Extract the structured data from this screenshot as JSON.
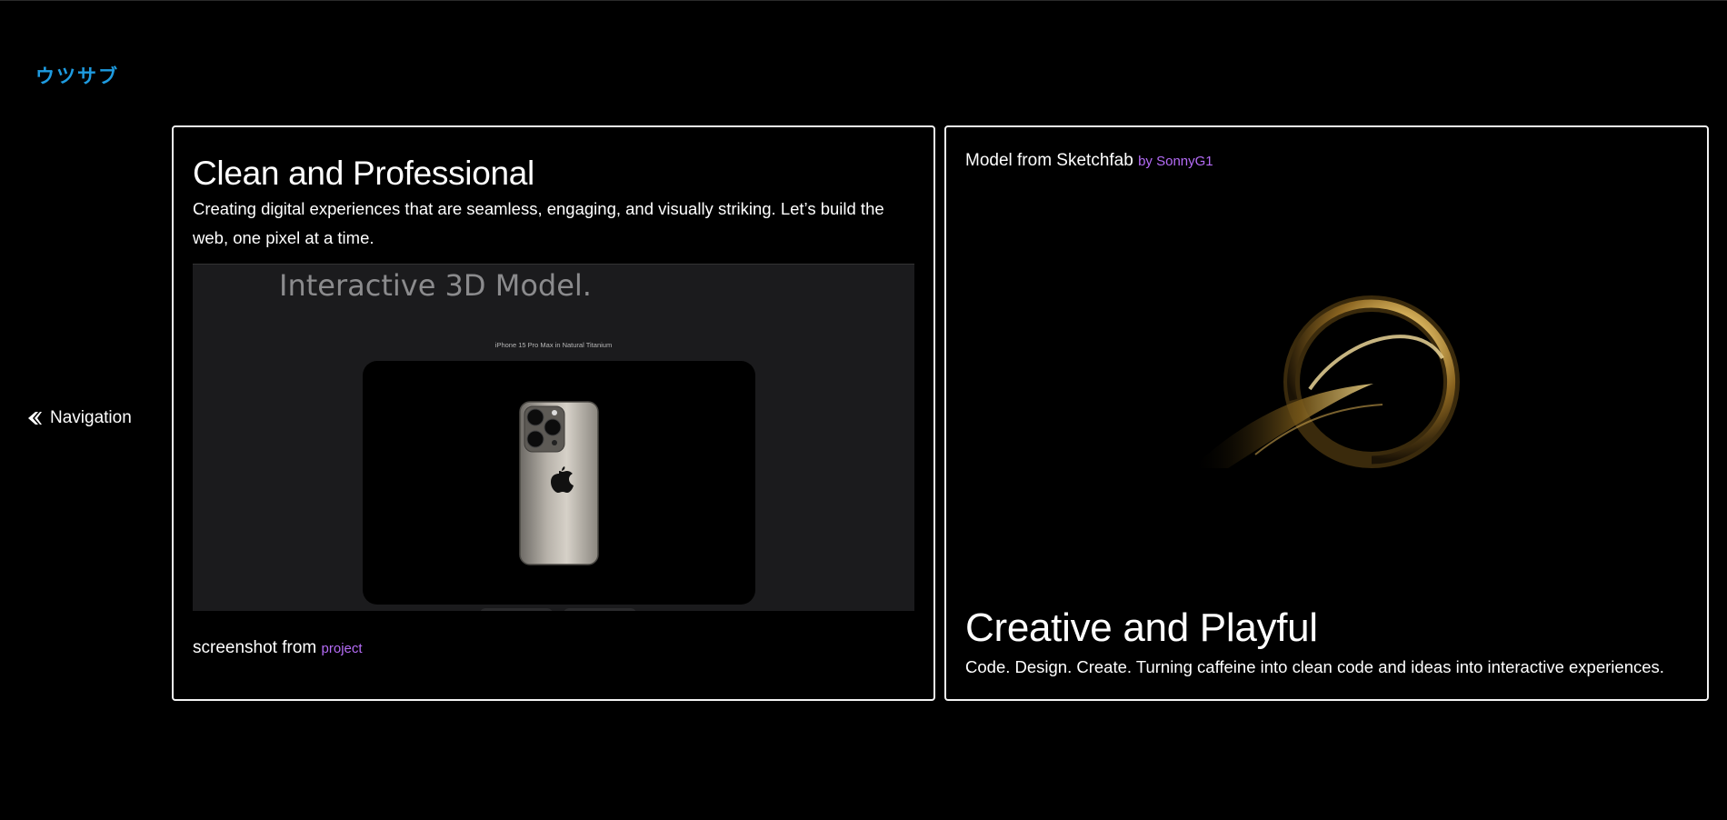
{
  "brand": {
    "logo_text": "ウツサブ"
  },
  "nav": {
    "toggle_label": "Navigation",
    "icon": "chevron-left-icon"
  },
  "cards": {
    "left": {
      "title": "Clean and Professional",
      "description": "Creating digital experiences that are seamless, engaging, and visually striking. Let’s build the web, one pixel at a time.",
      "screenshot": {
        "heading": "Interactive 3D Model.",
        "caption": "iPhone 15 Pro Max in Natural Titanium"
      },
      "credit_prefix": "screenshot from",
      "credit_link": "project"
    },
    "right": {
      "credit_prefix": "Model from Sketchfab",
      "credit_link": "by SonnyG1",
      "title": "Creative and Playful",
      "description": "Code. Design. Create. Turning caffeine into clean code and ideas into interactive experiences."
    }
  },
  "colors": {
    "brand": "#1e9be0",
    "accent_link": "#b56cf7",
    "background": "#000000",
    "card_border": "#f2f2f2"
  }
}
